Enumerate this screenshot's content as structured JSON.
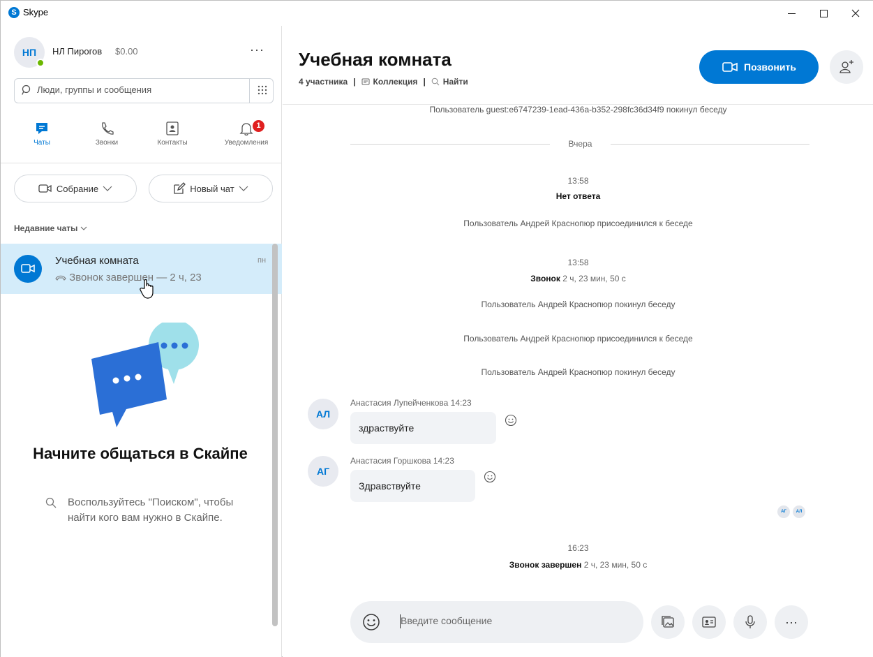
{
  "window": {
    "app_title": "Skype",
    "logo_letter": "S"
  },
  "profile": {
    "initials": "НП",
    "name": "НЛ Пирогов",
    "credit": "$0.00",
    "more": "···"
  },
  "search": {
    "placeholder": "Люди, группы и сообщения"
  },
  "nav": {
    "chats": "Чаты",
    "calls": "Звонки",
    "contacts": "Контакты",
    "notifications": "Уведомления",
    "notifications_badge": "1",
    "active": "chats",
    "accent_color": "#0078d4"
  },
  "actions": {
    "meeting": "Собрание",
    "new_chat": "Новый чат"
  },
  "recent": {
    "label": "Недавние чаты",
    "chats": [
      {
        "title": "Учебная комната",
        "preview": "Звонок завершен — 2 ч, 23",
        "day": "пн",
        "selected": true
      }
    ]
  },
  "empty_state": {
    "title": "Начните общаться в Скайпе",
    "hint": "Воспользуйтесь \"Поиском\", чтобы найти кого вам нужно в Скайпе."
  },
  "conversation": {
    "title": "Учебная комната",
    "participants": "4 участника",
    "gallery": "Коллекция",
    "find": "Найти",
    "call_button": "Позвонить",
    "events": {
      "guest_left": "Пользователь guest:e6747239-1ead-436a-b352-298fc36d34f9 покинул беседу",
      "day_separator": "Вчера",
      "time1": "13:58",
      "no_answer": "Нет ответа",
      "joined1": "Пользователь Андрей Краснопюр присоединился к беседе",
      "time2": "13:58",
      "call_label": "Звонок",
      "call_duration": "2 ч, 23 мин, 50 с",
      "left1": "Пользователь Андрей Краснопюр покинул беседу",
      "joined2": "Пользователь Андрей Краснопюр присоединился к беседе",
      "left2": "Пользователь Андрей Краснопюр покинул беседу",
      "time3": "16:23",
      "call_ended_label": "Звонок завершен",
      "call_ended_duration": "2 ч, 23 мин, 50 с"
    },
    "messages": [
      {
        "initials": "АЛ",
        "author": "Анастасия Лупейченкова",
        "time": "14:23",
        "text": "здраствуйте"
      },
      {
        "initials": "АГ",
        "author": "Анастасия Горшкова",
        "time": "14:23",
        "text": "Здравствуйте"
      }
    ],
    "seen_by": [
      "АГ",
      "АЛ"
    ]
  },
  "composer": {
    "placeholder": "Введите сообщение",
    "more": "···"
  }
}
